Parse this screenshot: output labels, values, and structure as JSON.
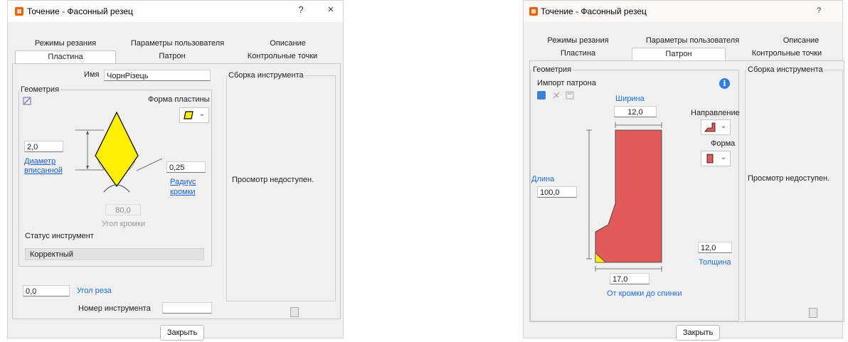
{
  "dialog_left": {
    "title": "Точение - Фасонный резец",
    "help_glyph": "?",
    "close_glyph": "×",
    "tabs_row1": [
      "Режимы резания",
      "Параметры пользователя",
      "Описание"
    ],
    "tabs_row2": [
      "Пластина",
      "Патрон",
      "Контрольные точки"
    ],
    "active_tab": "Пластина",
    "name_label": "Имя",
    "name_value": "ЧорнРізець",
    "geometry_title": "Геометрия",
    "insert_shape_label": "Форма пластины",
    "inscribed_value": "2,0",
    "inscribed_label_1": "Диаметр",
    "inscribed_label_2": "вписанной",
    "radius_value": "0,25",
    "radius_label_1": "Радиус",
    "radius_label_2": "кромки",
    "angle_value": "80,0",
    "angle_label": "Угол кромки",
    "status_label": "Статус инструмент",
    "status_value": "Корректный",
    "cut_angle_value": "0,0",
    "cut_angle_label": "Угол реза",
    "tool_number_label": "Номер инструмента",
    "tool_number_value": "",
    "assembly_title": "Сборка инструмента",
    "preview_text": "Просмотр недоступен.",
    "close_button": "Закрыть"
  },
  "dialog_right": {
    "title": "Точение - Фасонный резец",
    "help_glyph": "?",
    "tabs_row1": [
      "Режимы резания",
      "Параметры пользователя",
      "Описание"
    ],
    "tabs_row2": [
      "Пластина",
      "Патрон",
      "Контрольные точки"
    ],
    "active_tab": "Патрон",
    "geometry_title": "Геометрия",
    "import_label": "Импорт патрона",
    "width_label": "Ширина",
    "width_value": "12,0",
    "direction_label": "Направление",
    "shape_label": "Форма",
    "length_label": "Длина",
    "length_value": "100,0",
    "thickness_value": "12,0",
    "thickness_label": "Толщина",
    "edge_back_value": "17,0",
    "edge_back_label": "От кромки до спинки",
    "assembly_title": "Сборка инструмента",
    "preview_text": "Просмотр недоступен.",
    "close_button": "Закрыть"
  },
  "colors": {
    "insert_fill": "#ffee00",
    "holder_fill": "#e05a5a",
    "link_blue": "#1a5fd0",
    "accent_orange": "#e8630a"
  }
}
